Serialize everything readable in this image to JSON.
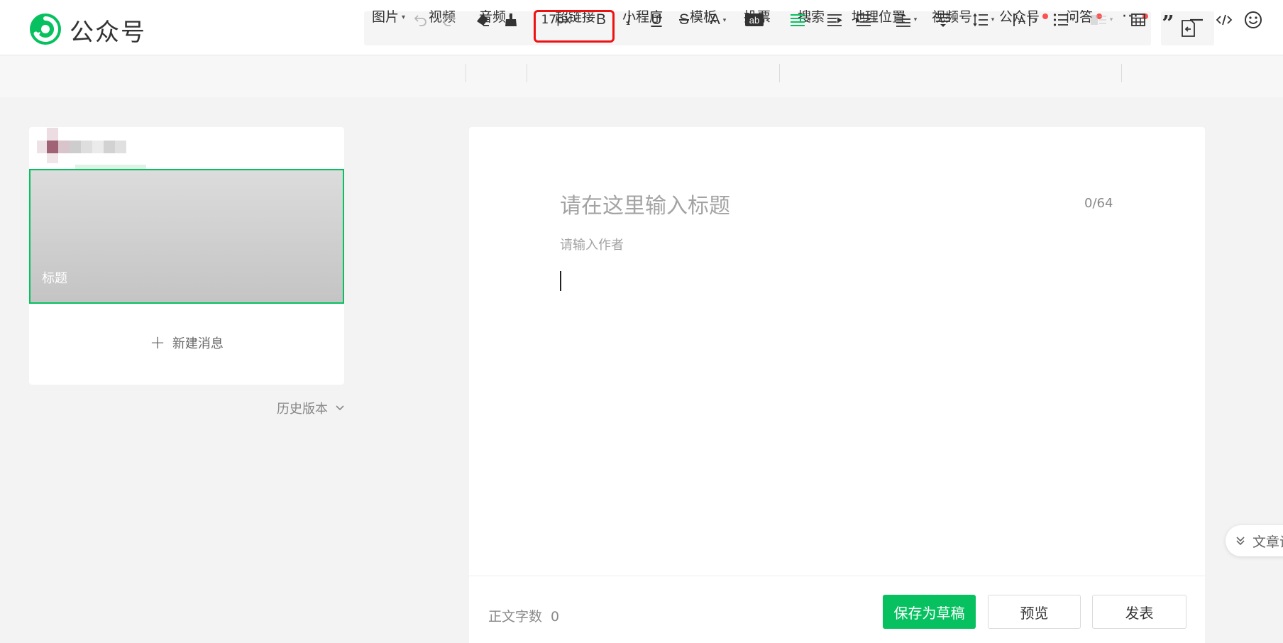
{
  "header": {
    "brand": "公众号",
    "insert_menu": {
      "image": "图片",
      "video": "视频",
      "audio": "音频",
      "hyperlink": "超链接",
      "mini_program": "小程序",
      "template": "模板",
      "vote": "投票",
      "search": "搜索",
      "location": "地理位置",
      "channels": "视频号",
      "official_account": "公众号",
      "qa": "问答",
      "more": "···"
    },
    "icons": {
      "logo": "wechat-official-account-logo-icon",
      "exit": "exit-editor-icon"
    },
    "colors": {
      "highlight_box": "#ee1111",
      "badge": "#fa5151"
    }
  },
  "toolbar": {
    "font_size": "17px",
    "icons": [
      "undo-icon",
      "redo-icon",
      "eraser-icon",
      "format-painter-icon",
      "bold-icon",
      "italic-icon",
      "underline-icon",
      "strikethrough-icon",
      "font-color-icon",
      "background-color-icon",
      "align-icon",
      "indent-icon",
      "first-line-indent-icon",
      "paragraph-spacing-top-icon",
      "paragraph-spacing-bottom-icon",
      "line-height-icon",
      "letter-spacing-icon",
      "list-icon",
      "image-style-icon",
      "table-icon",
      "quote-icon",
      "divider-icon",
      "code-icon",
      "emoji-icon"
    ]
  },
  "left_panel": {
    "cover_title": "标题",
    "new_message": "新建消息",
    "history": "历史版本"
  },
  "editor": {
    "title_placeholder": "请在这里输入标题",
    "title_count": "0/64",
    "author_placeholder": "请输入作者",
    "side_tab": "文章设"
  },
  "bottom": {
    "word_count_label": "正文字数",
    "word_count": "0",
    "save_draft": "保存为草稿",
    "preview": "预览",
    "publish": "发表"
  },
  "colors": {
    "accent": "#07c160"
  }
}
